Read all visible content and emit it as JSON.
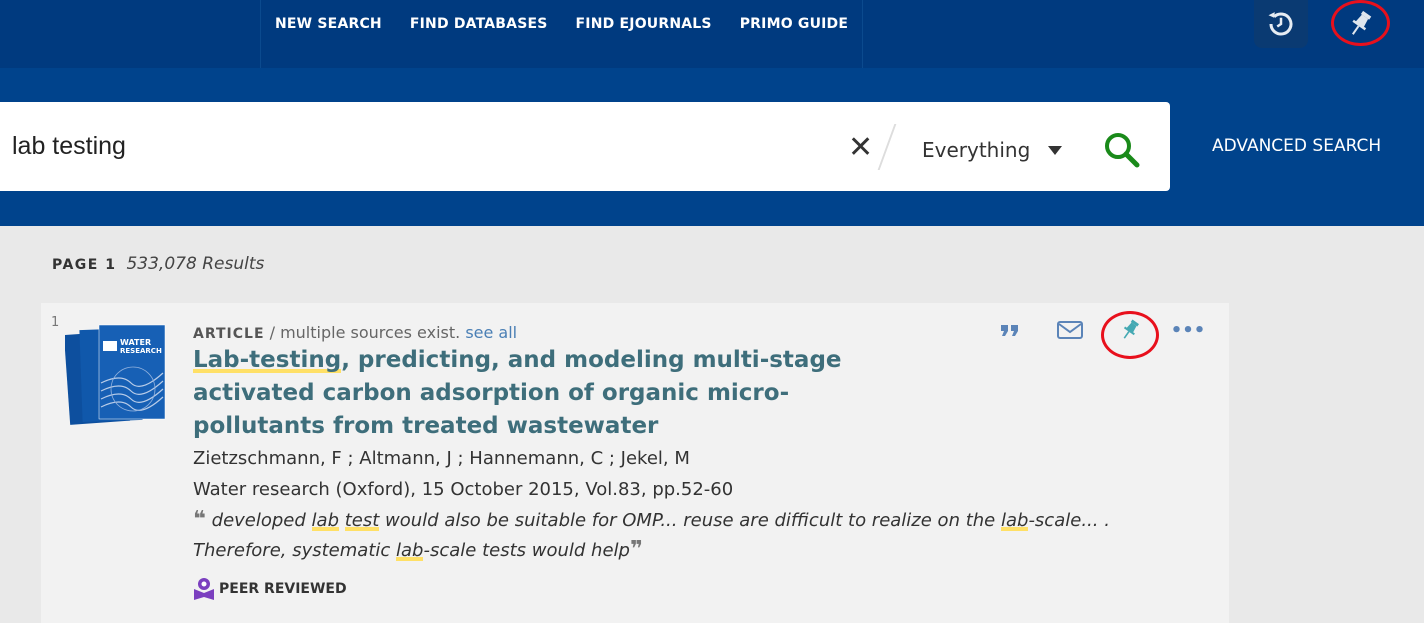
{
  "nav": {
    "items": [
      "NEW SEARCH",
      "FIND DATABASES",
      "FIND EJOURNALS",
      "PRIMO GUIDE"
    ]
  },
  "top_icons": [
    "history-icon",
    "pin-icon"
  ],
  "search": {
    "query": "lab testing",
    "scope": "Everything",
    "advanced_label": "ADVANCED SEARCH"
  },
  "results_header": {
    "page_label": "PAGE 1",
    "count": "533,078 Results"
  },
  "result": {
    "index": "1",
    "type": "ARTICLE",
    "sources_text": " / multiple sources exist. ",
    "see_all": "see all",
    "title_highlight": "Lab-testing",
    "title_rest": ", predicting, and modeling multi-stage activated carbon adsorption of organic micro-pollutants from treated wastewater",
    "authors": "Zietzschmann, F ; Altmann, J ; Hannemann, C ; Jekel, M",
    "source": "Water research (Oxford), 15 October 2015, Vol.83, pp.52-60",
    "snippet": [
      {
        "t": " developed ",
        "h": false
      },
      {
        "t": "lab",
        "h": true
      },
      {
        "t": " ",
        "h": false
      },
      {
        "t": "test",
        "h": true
      },
      {
        "t": " would also be suitable for OMP... reuse are difficult to realize on the ",
        "h": false
      },
      {
        "t": "lab",
        "h": true
      },
      {
        "t": "-scale... . Therefore, systematic ",
        "h": false
      },
      {
        "t": "lab",
        "h": true
      },
      {
        "t": "-scale tests would help",
        "h": false
      }
    ],
    "peer_reviewed": "PEER REVIEWED",
    "thumbnail_text": "WATER RESEARCH",
    "actions": [
      "cite-icon",
      "email-icon",
      "pin-icon",
      "more-icon"
    ]
  },
  "colors": {
    "topbar": "#003a7f",
    "searchband": "#00438c",
    "title": "#3e6e7b",
    "highlight": "#ffe066",
    "annotation_ring": "#e8101c",
    "pin_active": "#45a9b3"
  }
}
